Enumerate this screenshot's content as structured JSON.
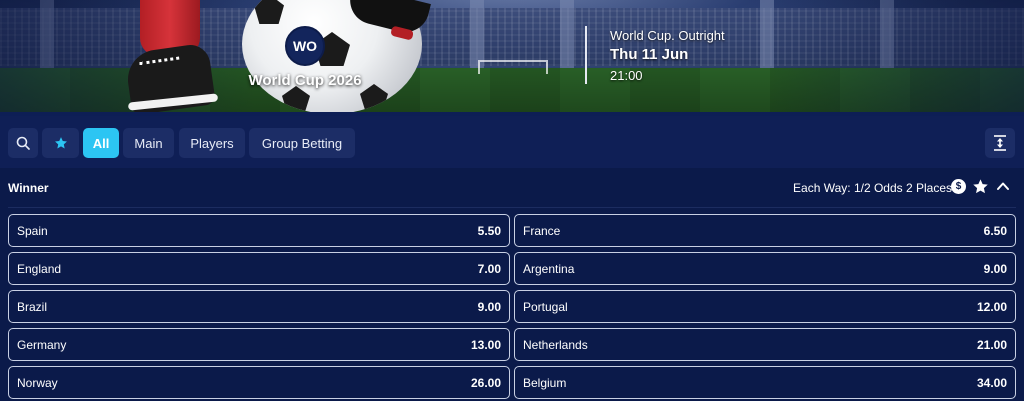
{
  "hero": {
    "badge": "WO",
    "competition": "World Cup 2026",
    "event_subtitle": "World Cup. Outright",
    "event_date": "Thu 11 Jun",
    "event_time": "21:00"
  },
  "toolbar": {
    "search_icon": "search-icon",
    "favourites_icon": "star-icon",
    "tabs": [
      "All",
      "Main",
      "Players",
      "Group Betting"
    ],
    "active_tab": "All",
    "collapse_icon": "collapse-all-icon"
  },
  "market": {
    "title": "Winner",
    "each_way": "Each Way: 1/2 Odds 2 Places",
    "cashout_icon": "dollar-icon",
    "favourite_icon": "star-icon",
    "collapse_icon": "chevron-up-icon",
    "selections": [
      {
        "name": "Spain",
        "odds": "5.50"
      },
      {
        "name": "France",
        "odds": "6.50"
      },
      {
        "name": "England",
        "odds": "7.00"
      },
      {
        "name": "Argentina",
        "odds": "9.00"
      },
      {
        "name": "Brazil",
        "odds": "9.00"
      },
      {
        "name": "Portugal",
        "odds": "12.00"
      },
      {
        "name": "Germany",
        "odds": "13.00"
      },
      {
        "name": "Netherlands",
        "odds": "21.00"
      },
      {
        "name": "Norway",
        "odds": "26.00"
      },
      {
        "name": "Belgium",
        "odds": "34.00"
      }
    ]
  },
  "colors": {
    "background": "#0b1a4a",
    "toolbar": "#0f1f56",
    "active_tab": "#2cc5f3",
    "star_accent": "#2cc5f3"
  }
}
